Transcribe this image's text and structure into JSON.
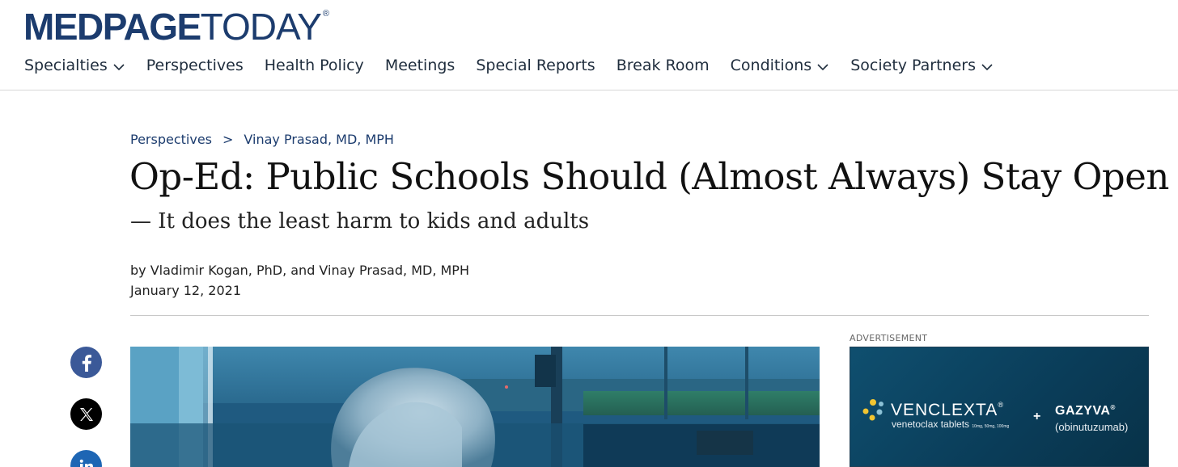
{
  "site": {
    "logo_bold": "MEDPAGE",
    "logo_light": "TODAY",
    "logo_mark": "®"
  },
  "nav": {
    "items": [
      {
        "label": "Specialties",
        "has_dropdown": true
      },
      {
        "label": "Perspectives",
        "has_dropdown": false
      },
      {
        "label": "Health Policy",
        "has_dropdown": false
      },
      {
        "label": "Meetings",
        "has_dropdown": false
      },
      {
        "label": "Special Reports",
        "has_dropdown": false
      },
      {
        "label": "Break Room",
        "has_dropdown": false
      },
      {
        "label": "Conditions",
        "has_dropdown": true
      },
      {
        "label": "Society Partners",
        "has_dropdown": true
      }
    ]
  },
  "breadcrumb": {
    "section": "Perspectives",
    "separator": ">",
    "author_page": "Vinay Prasad, MD, MPH"
  },
  "article": {
    "title": "Op-Ed: Public Schools Should (Almost Always) Stay Open",
    "subtitle": "— It does the least harm to kids and adults",
    "byline": "by Vladimir Kogan, PhD, and Vinay Prasad, MD, MPH",
    "date": "January 12, 2021"
  },
  "share": {
    "icons": [
      "facebook-icon",
      "x-icon",
      "linkedin-icon"
    ]
  },
  "ad": {
    "label": "ADVERTISEMENT",
    "brand1": "VENCLEXTA",
    "brand1_mark": "®",
    "brand1_sub": "venetoclax tablets",
    "brand1_dose": "10mg, 50mg, 100mg",
    "plus": "+",
    "brand2": "GAZYVA",
    "brand2_mark": "®",
    "brand2_sub": "(obinutuzumab)"
  },
  "colors": {
    "brand_navy": "#1c3c6e",
    "facebook": "#3b5998",
    "x": "#000000",
    "linkedin": "#1e66b4"
  }
}
